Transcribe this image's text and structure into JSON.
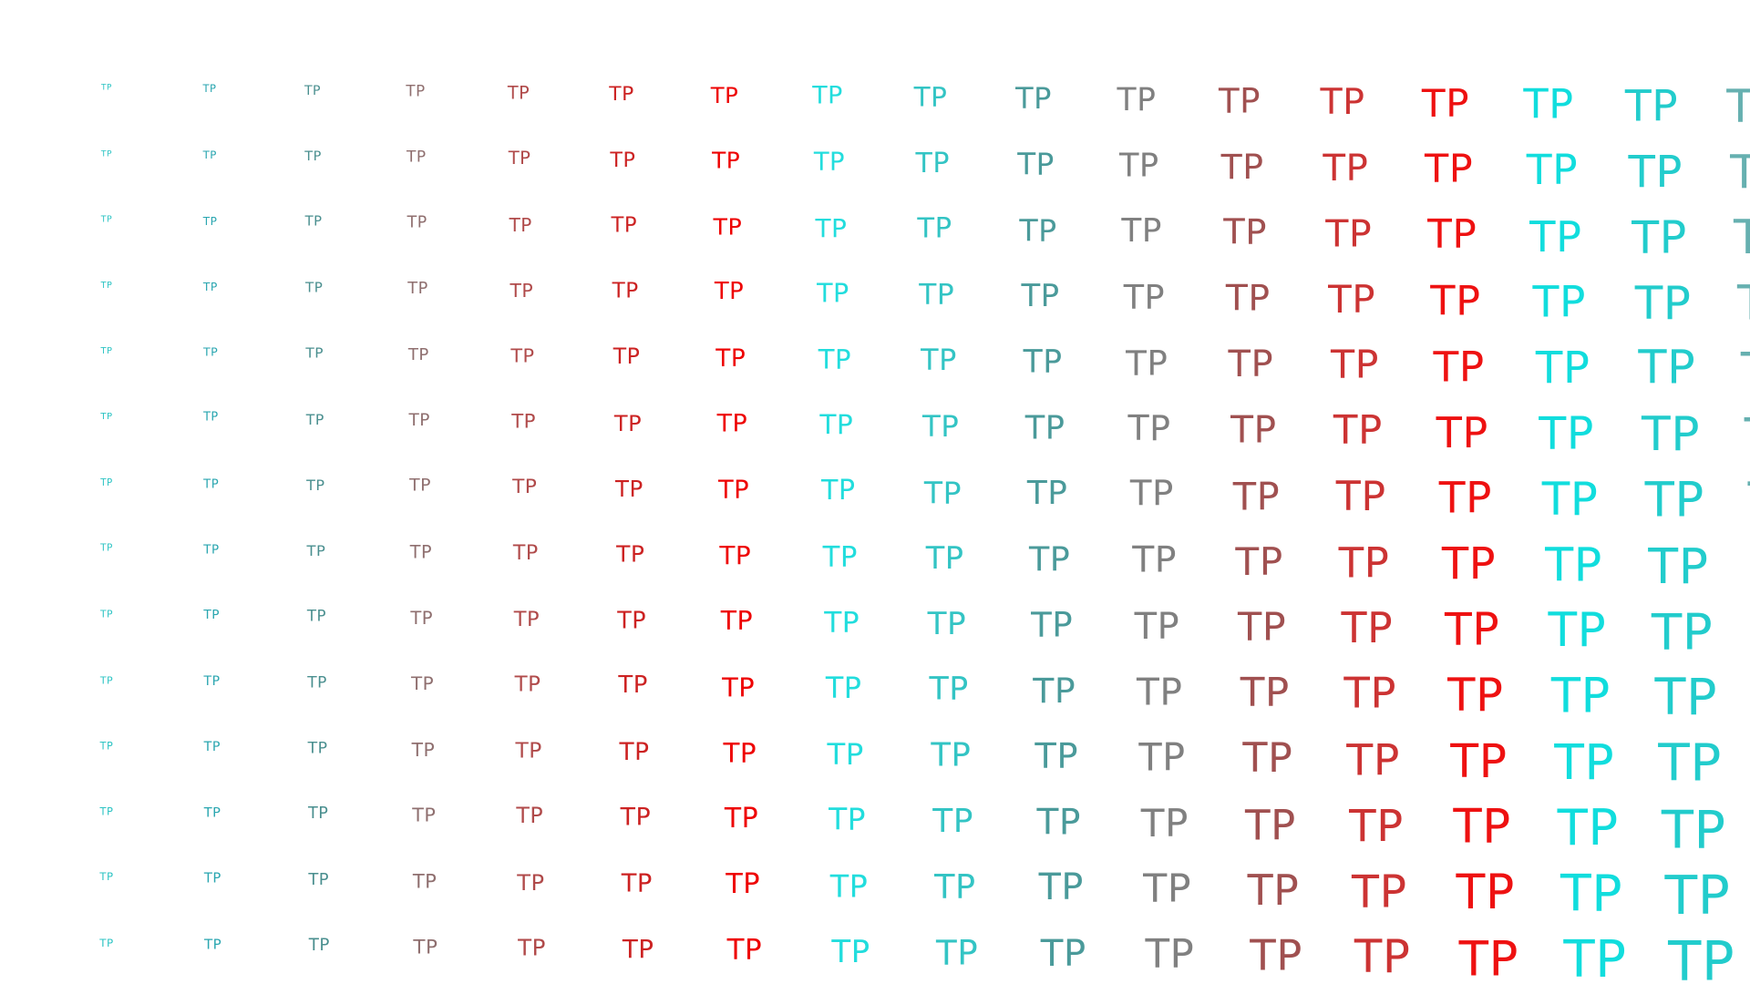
{
  "glyph_text": "TP",
  "grid": {
    "rows": 14,
    "columns": 17
  },
  "column_colors": [
    "#2ec4c4",
    "#2aa6b0",
    "#4a8f8f",
    "#8f6f6f",
    "#b04a4a",
    "#cc2222",
    "#ee0000",
    "#22dddd",
    "#33c4c4",
    "#4a9a9a",
    "#808080",
    "#a05050",
    "#cc3333",
    "#ee1111",
    "#11dddd",
    "#22cccc",
    "#66b0b0"
  ]
}
